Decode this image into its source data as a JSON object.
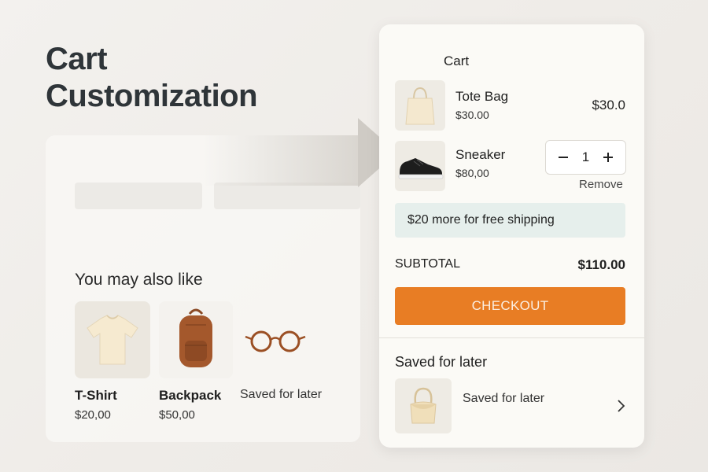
{
  "page": {
    "title_line1": "Cart",
    "title_line2": "Customization"
  },
  "recommendations": {
    "title": "You may also like",
    "items": [
      {
        "name": "T-Shirt",
        "price": "$20,00",
        "icon": "tshirt-icon"
      },
      {
        "name": "Backpack",
        "price": "$50,00",
        "icon": "backpack-icon"
      },
      {
        "label": "Saved for later",
        "icon": "glasses-icon"
      }
    ]
  },
  "cart": {
    "title": "Cart",
    "items": [
      {
        "name": "Tote Bag",
        "price": "$30.00",
        "line_total": "$30.0",
        "icon": "tote-bag-icon"
      },
      {
        "name": "Sneaker",
        "price": "$80,00",
        "quantity": "1",
        "remove_label": "Remove",
        "icon": "sneaker-icon"
      }
    ],
    "shipping_message": "$20 more for free shipping",
    "subtotal_label": "SUBTOTAL",
    "subtotal_value": "$110.00",
    "checkout_label": "CHECKOUT",
    "saved": {
      "title": "Saved for later",
      "item_label": "Saved for later",
      "icon": "handbag-icon"
    }
  },
  "colors": {
    "accent": "#e87d24",
    "banner_bg": "#e6efec",
    "title": "#2f3539"
  }
}
